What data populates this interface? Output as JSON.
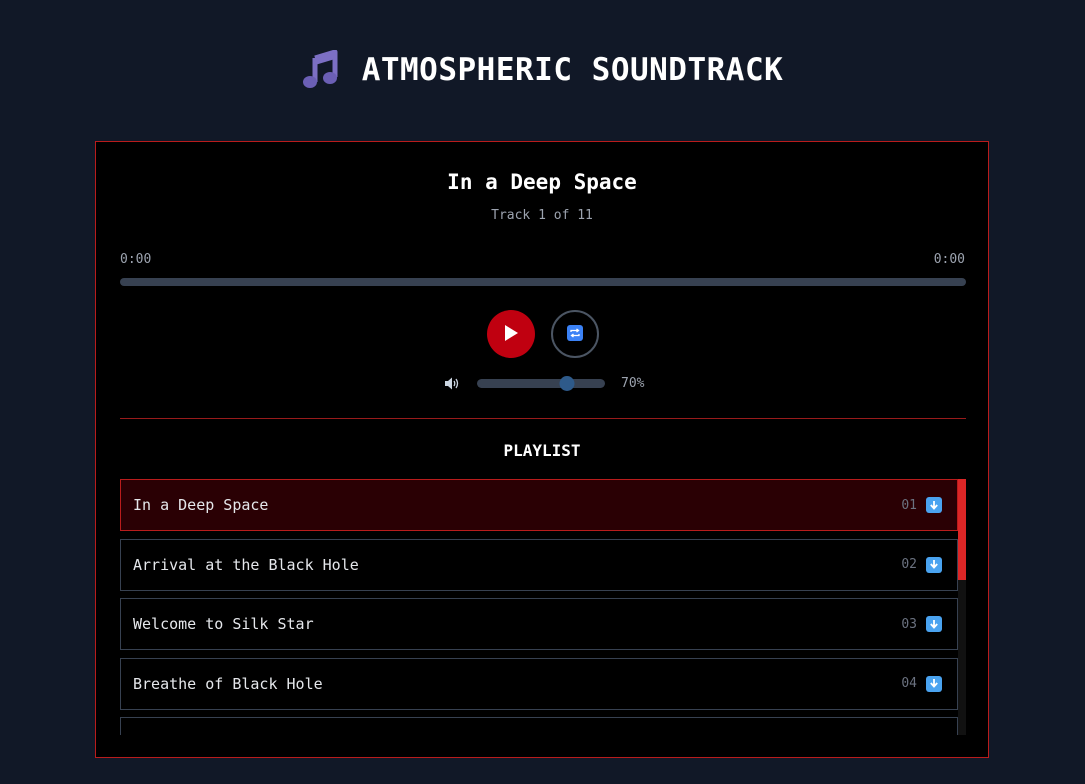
{
  "app": {
    "title": "ATMOSPHERIC SOUNDTRACK",
    "icon": "musical-notes-icon"
  },
  "player": {
    "track_title": "In a Deep Space",
    "track_count": "Track 1 of 11",
    "time_current": "0:00",
    "time_total": "0:00",
    "progress": 0,
    "volume_value": "70%",
    "volume_level": 0.7,
    "play_icon": "play-icon",
    "repeat_icon": "repeat-icon",
    "volume_icon": "speaker-icon",
    "accent_color": "#dc2626",
    "play_button_color": "#c00010"
  },
  "playlist": {
    "heading": "PLAYLIST",
    "items": [
      {
        "title": "In a Deep Space",
        "number": "01",
        "active": true
      },
      {
        "title": "Arrival at the Black Hole",
        "number": "02",
        "active": false
      },
      {
        "title": "Welcome to Silk Star",
        "number": "03",
        "active": false
      },
      {
        "title": "Breathe of Black Hole",
        "number": "04",
        "active": false
      },
      {
        "title": "",
        "number": "",
        "active": false
      }
    ],
    "item_icon": "download-icon"
  }
}
